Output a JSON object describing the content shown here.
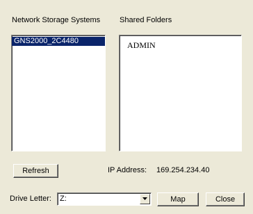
{
  "storage": {
    "label": "Network Storage Systems",
    "items": [
      {
        "label": "GNS2000_2C4480",
        "selected": true
      }
    ]
  },
  "folders": {
    "label": "Shared Folders",
    "items": [
      {
        "label": "ADMIN"
      }
    ]
  },
  "actions": {
    "refresh_label": "Refresh",
    "map_label": "Map",
    "close_label": "Close"
  },
  "ip": {
    "label": "IP Address:",
    "value": "169.254.234.40"
  },
  "drive": {
    "label": "Drive Letter:",
    "value": "Z:",
    "dropdown_icon": "chevron-down-icon"
  },
  "colors": {
    "background": "#ece9d8",
    "selection": "#0a246a"
  }
}
